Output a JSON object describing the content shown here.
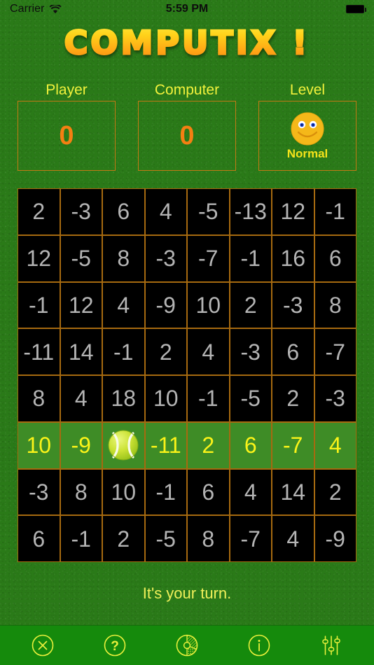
{
  "status_bar": {
    "carrier": "Carrier",
    "wifi_icon": "wifi-icon",
    "time": "5:59 PM",
    "battery_icon": "battery-full-icon"
  },
  "header": {
    "title": "COMPUTIX !",
    "title_gradient_from": "#ffe93c",
    "title_gradient_to": "#f78e10"
  },
  "scoreboard": {
    "player": {
      "caption": "Player",
      "value": "0"
    },
    "computer": {
      "caption": "Computer",
      "value": "0"
    },
    "level": {
      "caption": "Level",
      "value": "Normal",
      "face_icon": "smiley-face-icon"
    },
    "box_border_color": "#c47a15",
    "caption_color": "#f2f23c",
    "value_color": "#f57f12"
  },
  "board": {
    "rows": 8,
    "cols": 8,
    "cell_border_color": "#a66a10",
    "cell_bg_color": "#000000",
    "cell_text_color": "#b4b4b4",
    "highlight_bg_color": "#3e8c26",
    "highlight_text_color": "#faf319",
    "ball_icon": "tennis-ball-icon",
    "ball_position": {
      "row": 5,
      "col": 2
    },
    "highlight_row": 5,
    "grid": [
      [
        "2",
        "-3",
        "6",
        "4",
        "-5",
        "-13",
        "12",
        "-1"
      ],
      [
        "12",
        "-5",
        "8",
        "-3",
        "-7",
        "-1",
        "16",
        "6"
      ],
      [
        "-1",
        "12",
        "4",
        "-9",
        "10",
        "2",
        "-3",
        "8"
      ],
      [
        "-11",
        "14",
        "-1",
        "2",
        "4",
        "-3",
        "6",
        "-7"
      ],
      [
        "8",
        "4",
        "18",
        "10",
        "-1",
        "-5",
        "2",
        "-3"
      ],
      [
        "10",
        "-9",
        "",
        "-11",
        "2",
        "6",
        "-7",
        "4"
      ],
      [
        "-3",
        "8",
        "10",
        "-1",
        "6",
        "4",
        "14",
        "2"
      ],
      [
        "6",
        "-1",
        "2",
        "-5",
        "8",
        "-7",
        "4",
        "-9"
      ]
    ]
  },
  "turn_message": "It's your turn.",
  "toolbar": {
    "background_color": "#158a0c",
    "icon_color": "#eaf03c",
    "buttons": [
      {
        "name": "close-button",
        "icon": "close-circle-icon",
        "label": ""
      },
      {
        "name": "help-button",
        "icon": "question-circle-icon",
        "label": ""
      },
      {
        "name": "stats-button",
        "icon": "pie-chart-icon",
        "label": ""
      },
      {
        "name": "info-button",
        "icon": "info-circle-icon",
        "label": ""
      },
      {
        "name": "settings-button",
        "icon": "sliders-icon",
        "label": ""
      }
    ]
  }
}
